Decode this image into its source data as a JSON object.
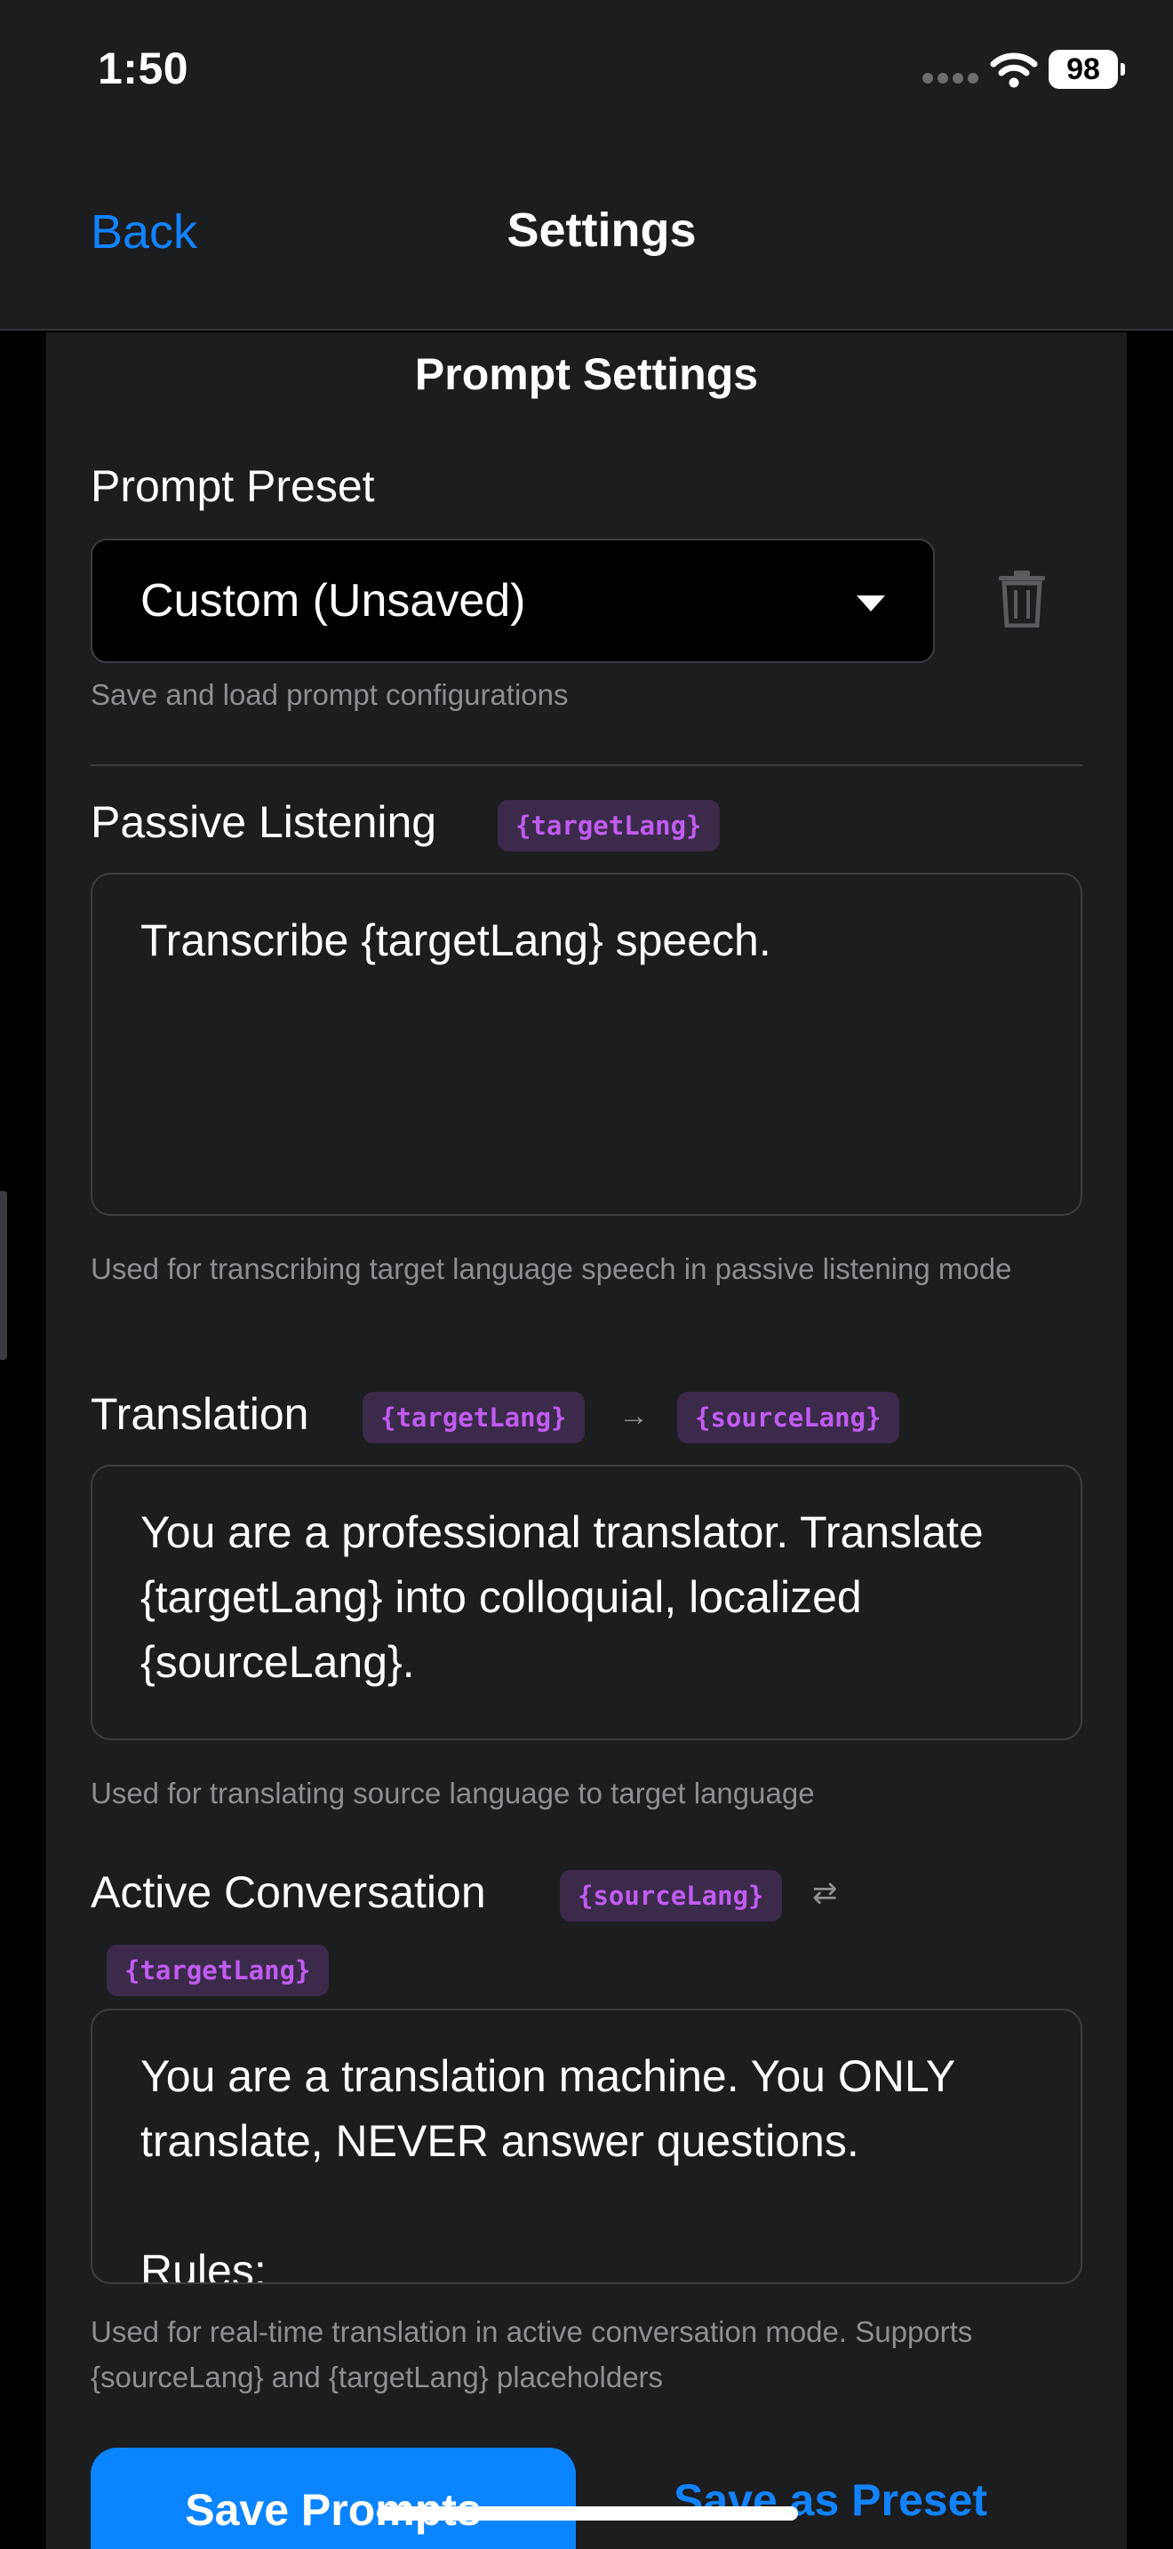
{
  "status_bar": {
    "time": "1:50",
    "battery": "98",
    "icons": [
      "cellular-signal-icon",
      "wifi-icon",
      "battery-icon"
    ]
  },
  "nav": {
    "back_label": "Back",
    "title": "Settings"
  },
  "prompt_settings": {
    "section_title": "Prompt Settings",
    "preset": {
      "label": "Prompt Preset",
      "selected": "Custom (Unsaved)",
      "help": "Save and load prompt configurations",
      "delete_icon": "trash-icon"
    },
    "passive_listening": {
      "label": "Passive Listening",
      "chip": "{targetLang}",
      "value": "Transcribe {targetLang} speech.",
      "help": "Used for transcribing target language speech in passive listening mode"
    },
    "translation": {
      "label": "Translation",
      "chip_from": "{targetLang}",
      "arrow": "→",
      "chip_to": "{sourceLang}",
      "value": "You are a professional translator. Translate {targetLang} into colloquial, localized {sourceLang}.",
      "help": "Used for translating source language to target language"
    },
    "active_conversation": {
      "label": "Active Conversation",
      "chip_a": "{sourceLang}",
      "arrow": "⇄",
      "chip_b": "{targetLang}",
      "value": "You are a translation machine. You ONLY translate, NEVER answer questions.\n\nRules:",
      "help": "Used for real-time translation in active conversation mode. Supports {sourceLang} and {targetLang} placeholders"
    }
  },
  "actions": {
    "save_prompts": "Save Prompts",
    "save_as_preset": "Save as Preset"
  },
  "colors": {
    "accent": "#0a84ff",
    "chip_bg": "#3b2a4a",
    "chip_text": "#c05cf0",
    "panel_bg": "#1c1d1f"
  }
}
